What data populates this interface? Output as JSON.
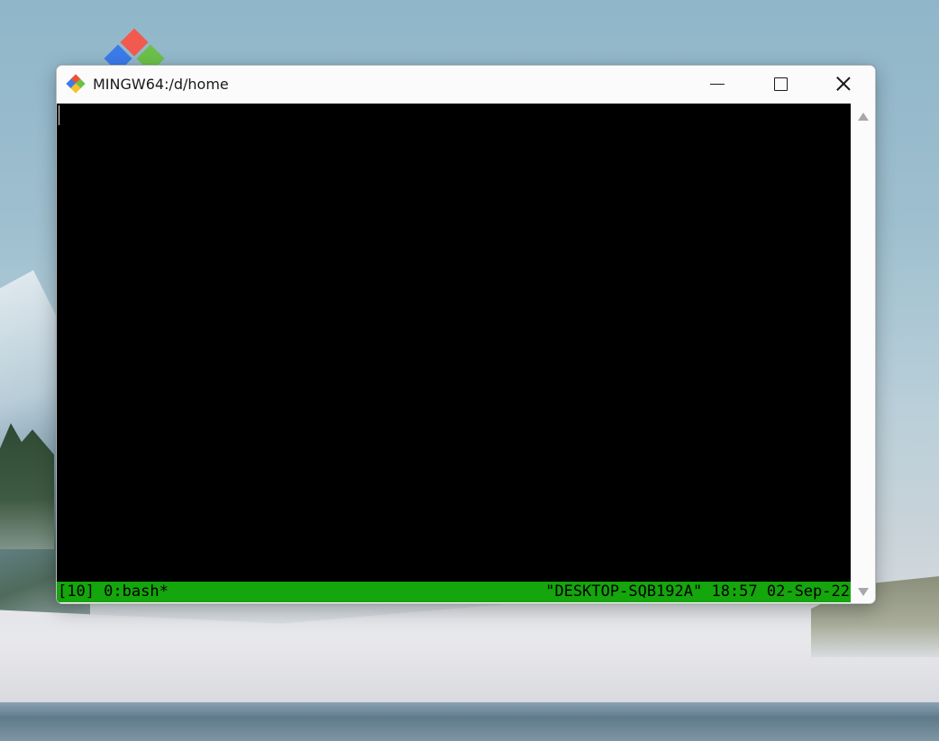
{
  "desktop": {
    "wallpaper": "snowy-mountain-landscape",
    "icons": [
      {
        "name": "git-logo-icon"
      }
    ]
  },
  "window": {
    "title": "MINGW64:/d/home",
    "app_icon": "git-bash-icon",
    "controls": {
      "minimize": "minimize-icon",
      "maximize": "maximize-icon",
      "close": "close-icon"
    }
  },
  "terminal": {
    "background": "#000000",
    "statusbar": {
      "color": "#15a50c",
      "left": "[10] 0:bash*",
      "right": "\"DESKTOP-SQB192A\" 18:57 02-Sep-22"
    }
  },
  "scrollbar": {
    "up": "scroll-up-arrow-icon",
    "down": "scroll-down-arrow-icon"
  }
}
